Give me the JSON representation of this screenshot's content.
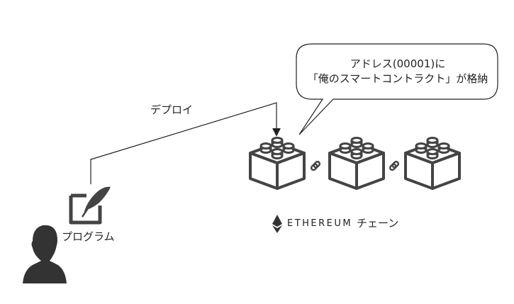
{
  "labels": {
    "deploy": "デプロイ",
    "program": "プログラム",
    "chain_brand": "ETHEREUM",
    "chain_suffix": "チェーン",
    "bubble_line1": "アドレス(00001)に",
    "bubble_line2": "「俺のスマートコントラクト」が格納"
  },
  "icons": [
    "user-icon",
    "quill-edit-icon",
    "block-icon",
    "chain-link-icon",
    "ethereum-diamond-icon"
  ],
  "colors": {
    "stroke": "#333333",
    "fill": "#444444",
    "background": "#ffffff"
  }
}
